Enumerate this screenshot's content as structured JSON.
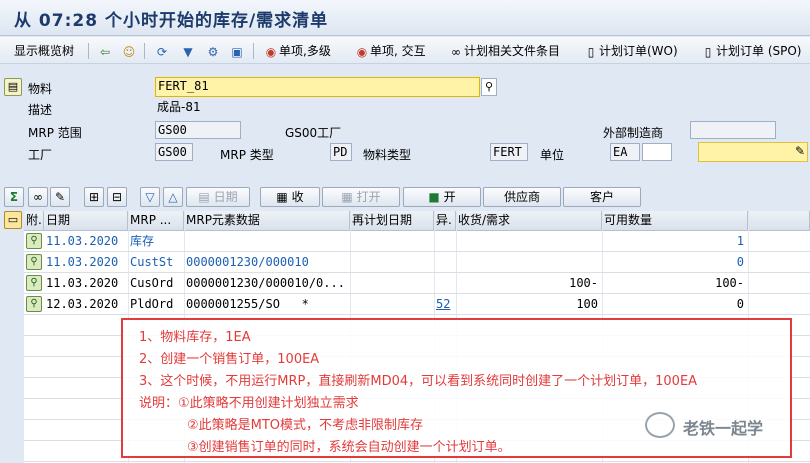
{
  "window": {
    "title": "从 07:28 个小时开始的库存/需求清单"
  },
  "toolbar": {
    "overview_tree": "显示概览树",
    "single_multi": "单项,多级",
    "single_cross": "单项, 交互",
    "plan_files": "计划相关文件条目",
    "planned_order_wo": "计划订单(WO)",
    "planned_order_spo": "计划订单 (SPO)"
  },
  "header": {
    "material_label": "物料",
    "material_value": "FERT_81",
    "desc_label": "描述",
    "desc_value": "成品-81",
    "mrp_area_label": "MRP 范围",
    "mrp_area_value": "GS00",
    "mrp_area_text": "GS00工厂",
    "ext_mfr_label": "外部制造商",
    "plant_label": "工厂",
    "plant_value": "GS00",
    "mrp_type_label": "MRP 类型",
    "mrp_type_value": "PD",
    "mat_type_label": "物料类型",
    "mat_type_value": "FERT",
    "unit_label": "单位",
    "unit_value": "EA"
  },
  "gridbar": {
    "date_btn": "日期",
    "receipt_btn": "收",
    "open_btn": "打开",
    "on_btn": "开",
    "vendor_btn": "供应商",
    "customer_btn": "客户"
  },
  "grid": {
    "headers": [
      "附.",
      "日期",
      "MRP ...",
      "MRP元素数据",
      "再计划日期",
      "异.",
      "收货/需求",
      "可用数量"
    ],
    "rows": [
      {
        "date": "11.03.2020",
        "elem": "库存",
        "data": "",
        "resched": "",
        "exc": "",
        "qty": "",
        "avail": "1",
        "blue": true
      },
      {
        "date": "11.03.2020",
        "elem": "CustSt",
        "data": "0000001230/000010",
        "resched": "",
        "exc": "",
        "qty": "",
        "avail": "0",
        "blue": true
      },
      {
        "date": "11.03.2020",
        "elem": "CusOrd",
        "data": "0000001230/000010/0...",
        "resched": "",
        "exc": "",
        "qty": "100-",
        "avail": "100-",
        "blue": false
      },
      {
        "date": "12.03.2020",
        "elem": "PldOrd",
        "data": "0000001255/SO   *",
        "resched": "",
        "exc": "52",
        "qty": "100",
        "avail": "0",
        "blue": false
      }
    ]
  },
  "note": {
    "line1": "1、物料库存，1EA",
    "line2": "2、创建一个销售订单，100EA",
    "line3": "3、这个时候，不用运行MRP，直接刷新MD04，可以看到系统同时创建了一个计划订单，100EA",
    "line4": "说明：①此策略不用创建计划独立需求",
    "line5": "②此策略是MTO模式，不考虑非限制库存",
    "line6": "③创建销售订单的同时，系统会自动创建一个计划订单。"
  },
  "watermark": "老铁一起学",
  "colors": {
    "note_red": "#e33a3a",
    "title_blue": "#1c3a6b",
    "highlight_yellow": "#fff3a8"
  }
}
